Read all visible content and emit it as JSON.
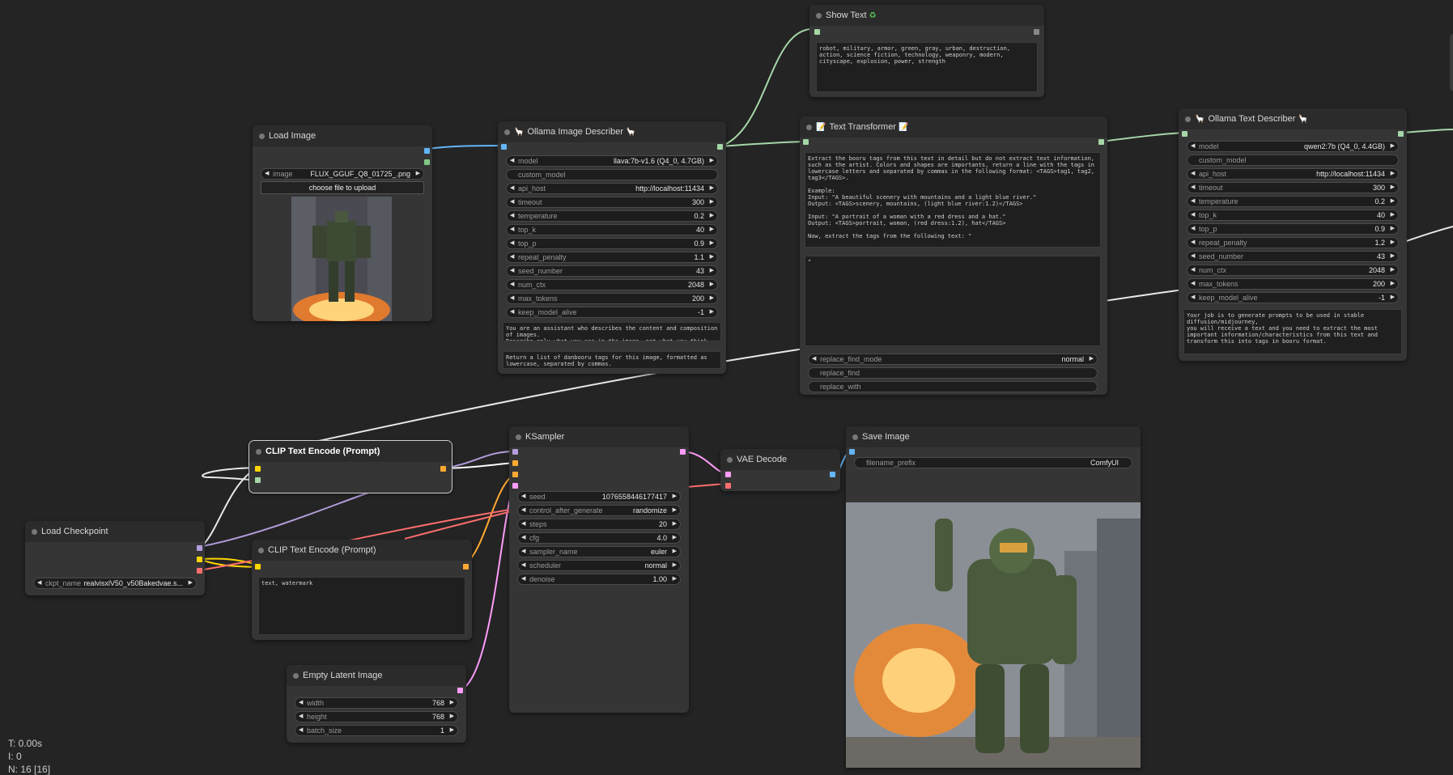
{
  "stats": {
    "time": "T: 0.00s",
    "iterations": "I: 0",
    "nodes": "N: 16 [16]"
  },
  "nodes": {
    "show_text": {
      "title": "Show Text",
      "text": "robot, military, armor, green, gray, urban, destruction, action, science fiction, technology, weaponry, modern, cityscape, explosion, power, strength"
    },
    "load_image": {
      "title": "Load Image",
      "image_label": "image",
      "image_value": "FLUX_GGUF_Q8_01725_.png",
      "upload_label": "choose file to upload"
    },
    "ollama_image": {
      "title": "Ollama Image Describer",
      "widgets": [
        {
          "label": "model",
          "value": "llava:7b-v1.6 (Q4_0, 4.7GB)"
        },
        {
          "label": "custom_model",
          "value": ""
        },
        {
          "label": "api_host",
          "value": "http://localhost:11434"
        },
        {
          "label": "timeout",
          "value": "300"
        },
        {
          "label": "temperature",
          "value": "0.2"
        },
        {
          "label": "top_k",
          "value": "40"
        },
        {
          "label": "top_p",
          "value": "0.9"
        },
        {
          "label": "repeat_penalty",
          "value": "1.1"
        },
        {
          "label": "seed_number",
          "value": "43"
        },
        {
          "label": "num_ctx",
          "value": "2048"
        },
        {
          "label": "max_tokens",
          "value": "200"
        },
        {
          "label": "keep_model_alive",
          "value": "-1"
        }
      ],
      "system_text": "You are an assistant who describes the content and composition of images.\nDescribe only what you see in the image, not what you think the",
      "prompt_text": "Return a list of danbooru tags for this image, formatted as lowercase, separated by commas."
    },
    "text_transformer": {
      "title": "Text Transformer",
      "text": "Extract the booru tags from this text in detail but do not extract text information, such as the artist. Colors and shapes are importants, return a line with the tags in lowercase letters and separated by commas in the following format: <TAGS>tag1, tag2, tag3</TAGS>.\n\nExample:\nInput: \"A beautiful scenery with mountains and a light blue river.\"\nOutput: <TAGS>scenery, mountains, (light blue river:1.2)</TAGS>\n\nInput: \"A portrait of a woman with a red dress and a hat.\"\nOutput: <TAGS>portrait, woman, (red dress:1.2), hat</TAGS>\n\nNow, extract the tags from the following text: \"",
      "text2": "\"",
      "widgets": [
        {
          "label": "replace_find_mode",
          "value": "normal"
        },
        {
          "label": "replace_find",
          "value": ""
        },
        {
          "label": "replace_with",
          "value": ""
        }
      ]
    },
    "ollama_text": {
      "title": "Ollama Text Describer",
      "widgets": [
        {
          "label": "model",
          "value": "qwen2:7b (Q4_0, 4.4GB)"
        },
        {
          "label": "custom_model",
          "value": ""
        },
        {
          "label": "api_host",
          "value": "http://localhost:11434"
        },
        {
          "label": "timeout",
          "value": "300"
        },
        {
          "label": "temperature",
          "value": "0.2"
        },
        {
          "label": "top_k",
          "value": "40"
        },
        {
          "label": "top_p",
          "value": "0.9"
        },
        {
          "label": "repeat_penalty",
          "value": "1.2"
        },
        {
          "label": "seed_number",
          "value": "43"
        },
        {
          "label": "num_ctx",
          "value": "2048"
        },
        {
          "label": "max_tokens",
          "value": "200"
        },
        {
          "label": "keep_model_alive",
          "value": "-1"
        }
      ],
      "system_text": "Your job is to generate prompts to be used in stable diffusion/midjourney,\nyou will receive a text and you need to extract the most important information/characteristics from this text and transform this into tags in booru format."
    },
    "clip_pos": {
      "title": "CLIP Text Encode (Prompt)"
    },
    "clip_neg": {
      "title": "CLIP Text Encode (Prompt)",
      "text": "text, watermark"
    },
    "load_checkpoint": {
      "title": "Load Checkpoint",
      "ckpt_label": "ckpt_name",
      "ckpt_value": "realvisxlV50_v50Bakedvae.s..."
    },
    "ksampler": {
      "title": "KSampler",
      "widgets": [
        {
          "label": "seed",
          "value": "1076558446177417"
        },
        {
          "label": "control_after_generate",
          "value": "randomize"
        },
        {
          "label": "steps",
          "value": "20"
        },
        {
          "label": "cfg",
          "value": "4.0"
        },
        {
          "label": "sampler_name",
          "value": "euler"
        },
        {
          "label": "scheduler",
          "value": "normal"
        },
        {
          "label": "denoise",
          "value": "1.00"
        }
      ]
    },
    "vae_decode": {
      "title": "VAE Decode"
    },
    "save_image": {
      "title": "Save Image",
      "prefix_label": "filename_prefix",
      "prefix_value": "ComfyUI"
    },
    "empty_latent": {
      "title": "Empty Latent Image",
      "widgets": [
        {
          "label": "width",
          "value": "768"
        },
        {
          "label": "height",
          "value": "768"
        },
        {
          "label": "batch_size",
          "value": "1"
        }
      ]
    }
  },
  "colors": {
    "clip": "#ffd500",
    "model": "#b39ddb",
    "latent": "#ff9cf9",
    "vae": "#ff6e6e",
    "image": "#64b5f6",
    "string": "#a5d6a7",
    "cond": "#ffa931"
  }
}
